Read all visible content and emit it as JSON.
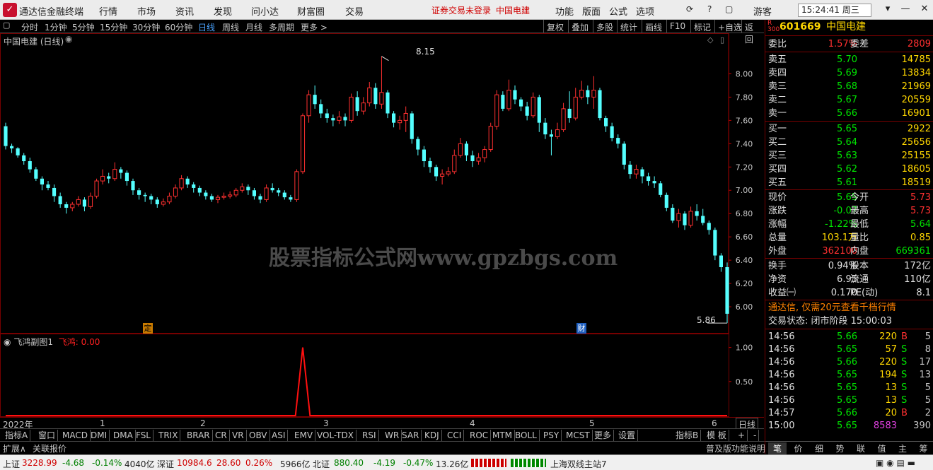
{
  "titlebar": {
    "app_title": "通达信金融终端",
    "menu": [
      "行情",
      "市场",
      "资讯",
      "发现",
      "问小达",
      "财富圈",
      "交易"
    ],
    "login_msg": "证券交易未登录",
    "stock_label": "中国电建",
    "menu_right": [
      "功能",
      "版面",
      "公式",
      "选项"
    ],
    "user": "游客",
    "clock": "15:24:41 周三"
  },
  "period_toolbar": {
    "items": [
      "分时",
      "1分钟",
      "5分钟",
      "15分钟",
      "30分钟",
      "60分钟",
      "日线",
      "周线",
      "月线",
      "多周期",
      "更多 >"
    ],
    "active": "日线",
    "right_items": [
      "复权",
      "叠加",
      "多股",
      "统计",
      "画线",
      "F10",
      "标记",
      "+自选",
      "返回"
    ]
  },
  "main_chart": {
    "title": "中国电建 (日线)",
    "high_label": "8.15",
    "low_label": "5.86",
    "markers": {
      "ding": "定",
      "cai": "财"
    },
    "watermark": "股票指标公式网www.gpzbgs.com"
  },
  "sub_chart": {
    "title": "飞鸿副图1",
    "series_label": "飞鸿: 0.00"
  },
  "date_axis": {
    "year_label": "2022年",
    "months": [
      "1",
      "2",
      "3",
      "4",
      "5",
      "6"
    ],
    "period_btn": "日线"
  },
  "chart_data": [
    {
      "type": "candlestick",
      "title": "中国电建 (日线)",
      "ylim": [
        5.8,
        8.3
      ],
      "y_ticks": [
        "8.00",
        "7.80",
        "7.60",
        "7.40",
        "7.20",
        "7.00",
        "6.80",
        "6.60",
        "6.40",
        "6.20",
        "6.00"
      ],
      "candles": [
        [
          7.55,
          7.38,
          7.58,
          7.35
        ],
        [
          7.38,
          7.36,
          7.4,
          7.32
        ],
        [
          7.36,
          7.3,
          7.37,
          7.28
        ],
        [
          7.3,
          7.25,
          7.32,
          7.22
        ],
        [
          7.25,
          7.18,
          7.28,
          7.15
        ],
        [
          7.18,
          7.1,
          7.2,
          7.08
        ],
        [
          7.1,
          7.05,
          7.12,
          7.0
        ],
        [
          7.05,
          7.02,
          7.08,
          7.0
        ],
        [
          7.02,
          6.95,
          7.05,
          6.9
        ],
        [
          6.95,
          6.88,
          6.98,
          6.85
        ],
        [
          6.88,
          6.85,
          6.9,
          6.8
        ],
        [
          6.85,
          6.88,
          6.9,
          6.82
        ],
        [
          6.88,
          6.92,
          6.95,
          6.86
        ],
        [
          6.92,
          6.86,
          6.94,
          6.82
        ],
        [
          6.86,
          6.95,
          6.98,
          6.84
        ],
        [
          6.95,
          7.08,
          7.1,
          6.93
        ],
        [
          7.08,
          7.12,
          7.18,
          7.05
        ],
        [
          7.12,
          7.1,
          7.15,
          7.06
        ],
        [
          7.1,
          7.18,
          7.24,
          7.08
        ],
        [
          7.18,
          7.15,
          7.2,
          7.1
        ],
        [
          7.15,
          7.08,
          7.17,
          7.04
        ],
        [
          7.08,
          7.0,
          7.1,
          6.96
        ],
        [
          7.0,
          6.96,
          7.02,
          6.92
        ],
        [
          6.96,
          6.95,
          6.98,
          6.9
        ],
        [
          6.95,
          6.92,
          6.97,
          6.88
        ],
        [
          6.92,
          6.88,
          6.94,
          6.85
        ],
        [
          6.88,
          6.9,
          6.93,
          6.86
        ],
        [
          6.9,
          6.95,
          6.98,
          6.88
        ],
        [
          6.95,
          7.02,
          7.05,
          6.93
        ],
        [
          7.02,
          7.1,
          7.13,
          7.0
        ],
        [
          7.1,
          7.05,
          7.12,
          7.02
        ],
        [
          7.05,
          7.02,
          7.07,
          6.98
        ],
        [
          7.02,
          6.98,
          7.04,
          6.95
        ],
        [
          6.98,
          6.95,
          7.0,
          6.92
        ],
        [
          6.95,
          6.92,
          6.97,
          6.9
        ],
        [
          6.92,
          6.94,
          6.96,
          6.89
        ],
        [
          6.94,
          6.95,
          6.98,
          6.92
        ],
        [
          6.95,
          6.96,
          6.99,
          6.93
        ],
        [
          6.96,
          7.0,
          7.02,
          6.94
        ],
        [
          7.0,
          7.03,
          7.06,
          6.98
        ],
        [
          7.03,
          7.0,
          7.05,
          6.96
        ],
        [
          7.0,
          6.95,
          7.02,
          6.92
        ],
        [
          6.95,
          6.92,
          6.97,
          6.89
        ],
        [
          6.92,
          7.02,
          7.05,
          6.9
        ],
        [
          7.02,
          7.0,
          7.06,
          6.98
        ],
        [
          7.0,
          6.98,
          7.02,
          6.95
        ],
        [
          6.98,
          6.94,
          7.0,
          6.92
        ],
        [
          6.94,
          6.92,
          6.96,
          6.9
        ],
        [
          6.92,
          7.16,
          7.18,
          6.9
        ],
        [
          7.16,
          7.64,
          7.66,
          7.14
        ],
        [
          7.64,
          7.82,
          7.86,
          7.58
        ],
        [
          7.82,
          7.74,
          7.9,
          7.7
        ],
        [
          7.74,
          7.66,
          7.78,
          7.62
        ],
        [
          7.66,
          7.62,
          7.7,
          7.58
        ],
        [
          7.62,
          7.6,
          7.65,
          7.55
        ],
        [
          7.6,
          7.63,
          7.68,
          7.57
        ],
        [
          7.63,
          7.6,
          7.66,
          7.55
        ],
        [
          7.6,
          7.8,
          7.83,
          7.58
        ],
        [
          7.8,
          7.68,
          7.85,
          7.64
        ],
        [
          7.68,
          7.75,
          7.8,
          7.65
        ],
        [
          7.75,
          7.88,
          7.93,
          7.72
        ],
        [
          7.88,
          7.74,
          7.92,
          7.7
        ],
        [
          7.74,
          7.84,
          8.15,
          7.7
        ],
        [
          7.84,
          7.66,
          7.86,
          7.62
        ],
        [
          7.66,
          7.58,
          7.68,
          7.54
        ],
        [
          7.58,
          7.6,
          7.64,
          7.52
        ],
        [
          7.6,
          7.66,
          7.72,
          7.5
        ],
        [
          7.66,
          7.44,
          7.68,
          7.4
        ],
        [
          7.44,
          7.35,
          7.46,
          7.3
        ],
        [
          7.35,
          7.25,
          7.38,
          7.2
        ],
        [
          7.25,
          7.2,
          7.28,
          7.15
        ],
        [
          7.2,
          7.12,
          7.22,
          7.08
        ],
        [
          7.12,
          7.14,
          7.18,
          7.05
        ],
        [
          7.14,
          7.16,
          7.2,
          7.12
        ],
        [
          7.16,
          7.3,
          7.35,
          7.14
        ],
        [
          7.3,
          7.4,
          7.45,
          7.28
        ],
        [
          7.4,
          7.3,
          7.42,
          7.25
        ],
        [
          7.3,
          7.25,
          7.34,
          7.2
        ],
        [
          7.25,
          7.28,
          7.32,
          7.22
        ],
        [
          7.28,
          7.35,
          7.38,
          7.24
        ],
        [
          7.35,
          7.55,
          7.58,
          7.33
        ],
        [
          7.55,
          7.82,
          7.86,
          7.52
        ],
        [
          7.82,
          7.7,
          7.85,
          7.68
        ],
        [
          7.7,
          7.86,
          7.95,
          7.68
        ],
        [
          7.86,
          7.78,
          7.9,
          7.74
        ],
        [
          7.78,
          7.72,
          7.8,
          7.68
        ],
        [
          7.72,
          7.64,
          7.76,
          7.6
        ],
        [
          7.64,
          7.8,
          7.84,
          7.62
        ],
        [
          7.8,
          7.58,
          7.82,
          7.5
        ],
        [
          7.58,
          7.48,
          7.62,
          7.44
        ],
        [
          7.48,
          7.46,
          7.52,
          7.3
        ],
        [
          7.46,
          7.52,
          7.58,
          7.44
        ],
        [
          7.52,
          7.7,
          7.75,
          7.5
        ],
        [
          7.7,
          7.62,
          7.85,
          7.58
        ],
        [
          7.62,
          7.8,
          7.88,
          7.6
        ],
        [
          7.8,
          7.86,
          7.94,
          7.78
        ],
        [
          7.86,
          7.8,
          7.9,
          7.74
        ],
        [
          7.8,
          7.86,
          7.98,
          7.7
        ],
        [
          7.86,
          7.62,
          7.88,
          7.6
        ],
        [
          7.62,
          7.55,
          7.64,
          7.5
        ],
        [
          7.55,
          7.45,
          7.58,
          7.42
        ],
        [
          7.45,
          7.4,
          7.48,
          7.36
        ],
        [
          7.4,
          7.22,
          7.42,
          7.18
        ],
        [
          7.22,
          7.14,
          7.25,
          7.1
        ],
        [
          7.14,
          7.18,
          7.22,
          7.1
        ],
        [
          7.18,
          7.12,
          7.2,
          7.06
        ],
        [
          7.12,
          7.08,
          7.15,
          7.04
        ],
        [
          7.08,
          7.06,
          7.12,
          7.02
        ],
        [
          7.06,
          6.96,
          7.08,
          6.94
        ],
        [
          6.96,
          6.85,
          6.98,
          6.82
        ],
        [
          6.85,
          6.74,
          6.88,
          6.72
        ],
        [
          6.74,
          6.8,
          6.84,
          6.68
        ],
        [
          6.8,
          6.7,
          6.82,
          6.66
        ],
        [
          6.7,
          6.82,
          6.86,
          6.68
        ],
        [
          6.82,
          6.78,
          6.88,
          6.74
        ],
        [
          6.78,
          6.72,
          6.84,
          6.7
        ],
        [
          6.72,
          6.66,
          6.74,
          6.62
        ],
        [
          6.66,
          6.44,
          6.68,
          6.4
        ],
        [
          6.44,
          6.34,
          6.46,
          6.3
        ],
        [
          6.34,
          5.94,
          6.38,
          5.86
        ]
      ],
      "last_close": 5.65
    },
    {
      "type": "line",
      "title": "飞鸿副图1",
      "name": "飞鸿",
      "ylim": [
        0,
        1.1
      ],
      "y_ticks": [
        "1.00",
        "0.50"
      ],
      "spike_index": 49,
      "spike_value": 1.0,
      "baseline": 0.0
    }
  ],
  "right_panel": {
    "badge": "R 300",
    "code": "601669",
    "name": "中国电建",
    "weibi_label": "委比",
    "weibi": "1.57%",
    "weicha_label": "委差",
    "weicha": "2809",
    "asks": [
      {
        "label": "卖五",
        "price": "5.70",
        "vol": "14785"
      },
      {
        "label": "卖四",
        "price": "5.69",
        "vol": "13834"
      },
      {
        "label": "卖三",
        "price": "5.68",
        "vol": "21969"
      },
      {
        "label": "卖二",
        "price": "5.67",
        "vol": "20559"
      },
      {
        "label": "卖一",
        "price": "5.66",
        "vol": "16901"
      }
    ],
    "bids": [
      {
        "label": "买一",
        "price": "5.65",
        "vol": "2922"
      },
      {
        "label": "买二",
        "price": "5.64",
        "vol": "25656"
      },
      {
        "label": "买三",
        "price": "5.63",
        "vol": "25155"
      },
      {
        "label": "买四",
        "price": "5.62",
        "vol": "18605"
      },
      {
        "label": "买五",
        "price": "5.61",
        "vol": "18519"
      }
    ],
    "stats": [
      {
        "l1": "现价",
        "v1": "5.65",
        "l2": "今开",
        "v2": "5.73",
        "c1": "green",
        "c2": "red"
      },
      {
        "l1": "涨跌",
        "v1": "-0.07",
        "l2": "最高",
        "v2": "5.73",
        "c1": "green",
        "c2": "red"
      },
      {
        "l1": "涨幅",
        "v1": "-1.22%",
        "l2": "最低",
        "v2": "5.64",
        "c1": "green",
        "c2": "green"
      },
      {
        "l1": "总量",
        "v1": "103.1万",
        "l2": "量比",
        "v2": "0.85",
        "c1": "yel",
        "c2": "yel"
      },
      {
        "l1": "外盘",
        "v1": "362100",
        "l2": "内盘",
        "v2": "669361",
        "c1": "red",
        "c2": "green"
      }
    ],
    "stats2": [
      {
        "l1": "换手",
        "v1": "0.94%",
        "l2": "股本",
        "v2": "172亿"
      },
      {
        "l1": "净资",
        "v1": "6.95",
        "l2": "流通",
        "v2": "110亿"
      },
      {
        "l1": "收益㈠",
        "v1": "0.170",
        "l2": "PE(动)",
        "v2": "8.1"
      }
    ],
    "promo": "通达信, 仅需20元查看千档行情",
    "trade_status": "交易状态: 闭市阶段 15:00:03",
    "ticks": [
      {
        "t": "14:56",
        "p": "5.66",
        "v": "220",
        "bs": "B",
        "n": "5"
      },
      {
        "t": "14:56",
        "p": "5.65",
        "v": "57",
        "bs": "S",
        "n": "8"
      },
      {
        "t": "14:56",
        "p": "5.66",
        "v": "220",
        "bs": "S",
        "n": "17"
      },
      {
        "t": "14:56",
        "p": "5.65",
        "v": "194",
        "bs": "S",
        "n": "13"
      },
      {
        "t": "14:56",
        "p": "5.65",
        "v": "13",
        "bs": "S",
        "n": "5"
      },
      {
        "t": "14:56",
        "p": "5.65",
        "v": "13",
        "bs": "S",
        "n": "5"
      },
      {
        "t": "14:57",
        "p": "5.66",
        "v": "20",
        "bs": "B",
        "n": "2"
      },
      {
        "t": "15:00",
        "p": "5.65",
        "v": "8583",
        "bs": "",
        "n": "390"
      }
    ],
    "bottom_tabs": [
      "笔",
      "价",
      "细",
      "势",
      "联",
      "值",
      "主",
      "筹"
    ]
  },
  "indicator_tabs": [
    "指标A",
    "窗口",
    "MACD",
    "DMI",
    "DMA",
    "FSL",
    "TRIX",
    "BRAR",
    "CR",
    "VR",
    "OBV",
    "ASI",
    "EMV",
    "VOL-TDX",
    "RSI",
    "WR",
    "SAR",
    "KDJ",
    "CCI",
    "ROC",
    "MTM",
    "BOLL",
    "PSY",
    "MCST",
    "更多",
    "设置"
  ],
  "indicator_right": [
    "指标B",
    "模 板",
    "+",
    "-"
  ],
  "tabbar2": {
    "left": [
      "扩展∧",
      "关联报价"
    ],
    "right": "普及版功能说明"
  },
  "statusbar": {
    "sh_label": "上证",
    "sh_val": "3228.99",
    "sh_chg": "-4.68",
    "sh_pct": "-0.14%",
    "sh_amt": "4040亿",
    "sz_label": "深证",
    "sz_val": "10984.6",
    "sz_chg": "28.60",
    "sz_pct": "0.26%",
    "sz_amt": "5966亿",
    "bz_label": "北证",
    "bz_val": "880.40",
    "bz_chg": "-4.19",
    "bz_pct": "-0.47%",
    "bz_amt": "13.26亿",
    "server": "上海双线主站7"
  }
}
